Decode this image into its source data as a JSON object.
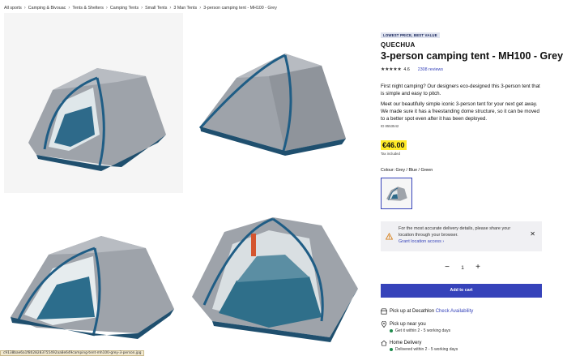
{
  "breadcrumb": [
    "All sports",
    "Camping & Bivouac",
    "Tents & Shelters",
    "Camping Tents",
    "Small Tents",
    "3 Man Tents",
    "3-person camping tent - MH100 - Grey"
  ],
  "gallery": {
    "images": [
      {
        "subject": "tent-front-door-open-icon"
      },
      {
        "subject": "tent-side-closed-icon"
      },
      {
        "subject": "tent-angle-door-open-icon"
      },
      {
        "subject": "tent-interior-view-icon"
      }
    ],
    "status_url": "c9138bae6a1f8028283755492aa8e649camping-tent-mh100-grey-3-person.jpg"
  },
  "product": {
    "badge": "LOWEST PRICE, BEST VALUE",
    "brand": "QUECHUA",
    "title": "3-person camping tent - MH100 - Grey",
    "rating_stars": "★★★★★",
    "rating_value": "4.6",
    "reviews_label": "2308 reviews",
    "description_1": "First night camping? Our designers eco-designed this 3-person tent that is simple and easy to pitch.",
    "description_2": "Meet our beautifully simple iconic 3-person tent for your next get away. We made sure it has a freestanding dome structure, so it can be moved to a better spot even after it has been deployed.",
    "product_id": "ID 8553542",
    "price": "€46.00",
    "tax_label": "Tax included",
    "colour_label": "Colour: Grey / Blue / Green"
  },
  "delivery_notice": {
    "text": "For the most accurate delivery details, please share your location through your browser.",
    "link": "Grant location access ›",
    "close": "✕"
  },
  "quantity": {
    "minus": "−",
    "value": "1",
    "plus": "+"
  },
  "cart": {
    "add_label": "Add to cart"
  },
  "shipping": {
    "pickup_store": {
      "label": "Pick up at Decathlon",
      "link": "Check Availability"
    },
    "pickup_near": {
      "label": "Pick up near you",
      "detail": "Get it within 2 - 5 working days"
    },
    "home": {
      "label": "Home Delivery",
      "detail": "Delivered within 2 - 5 working days"
    }
  },
  "colors": {
    "accent": "#3643ba",
    "price_bg": "#ffea28",
    "tent_grey": "#9ea3aa",
    "tent_blue": "#1f5d85",
    "in_stock": "#1f8a4c"
  }
}
